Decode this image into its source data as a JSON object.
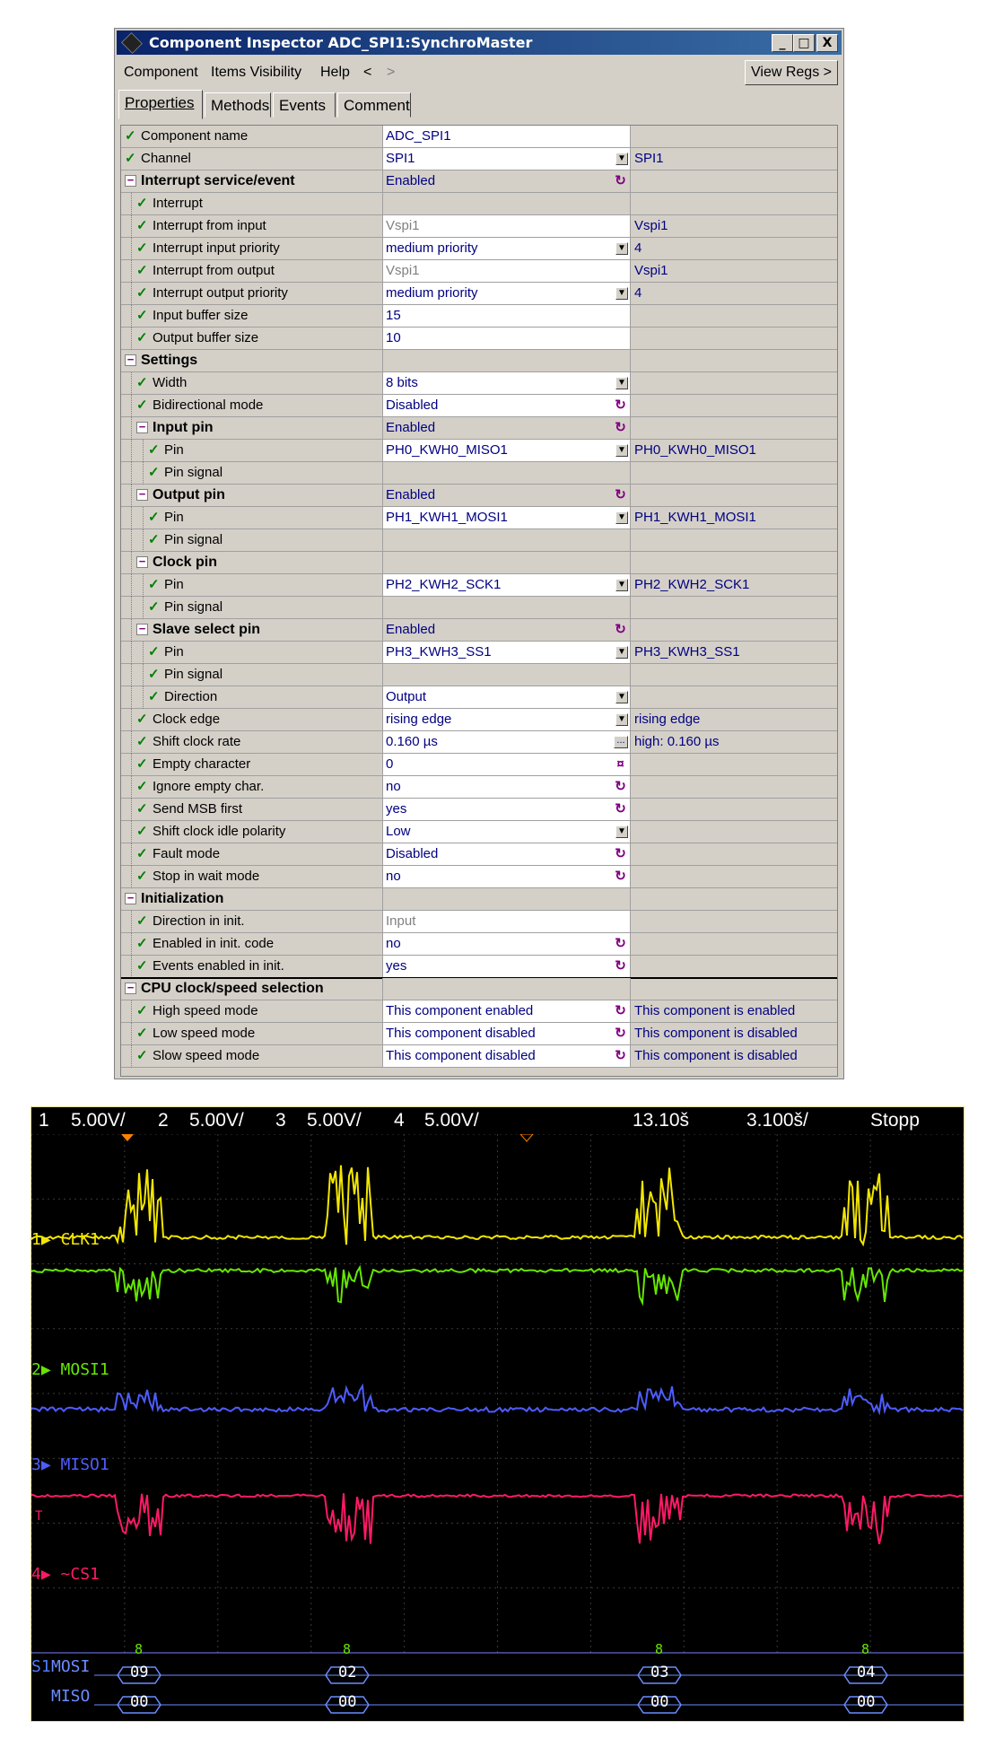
{
  "window": {
    "title": "Component Inspector ADC_SPI1:SynchroMaster",
    "buttons": {
      "minimize": "_",
      "maximize": "□",
      "close": "X"
    }
  },
  "menu": {
    "items": [
      "Component",
      "Items Visibility",
      "Help",
      "<",
      ">"
    ],
    "view_regs": "View Regs >"
  },
  "tabs": [
    "Properties",
    "Methods",
    "Events",
    "Comment"
  ],
  "rows": [
    {
      "name": "Component name",
      "value": "ADC_SPI1",
      "extra": ""
    },
    {
      "name": "Channel",
      "value": "SPI1",
      "extra": "SPI1"
    },
    {
      "name": "Interrupt service/event",
      "value": "Enabled",
      "extra": ""
    },
    {
      "name": "Interrupt",
      "value": "",
      "extra": ""
    },
    {
      "name": "Interrupt from input",
      "value": "Vspi1",
      "extra": "Vspi1"
    },
    {
      "name": "Interrupt input priority",
      "value": "medium priority",
      "extra": "4"
    },
    {
      "name": "Interrupt from output",
      "value": "Vspi1",
      "extra": "Vspi1"
    },
    {
      "name": "Interrupt output priority",
      "value": "medium priority",
      "extra": "4"
    },
    {
      "name": "Input buffer size",
      "value": "15",
      "extra": ""
    },
    {
      "name": "Output buffer size",
      "value": "10",
      "extra": ""
    },
    {
      "name": "Settings",
      "value": "",
      "extra": ""
    },
    {
      "name": "Width",
      "value": "8 bits",
      "extra": ""
    },
    {
      "name": "Bidirectional mode",
      "value": "Disabled",
      "extra": ""
    },
    {
      "name": "Input pin",
      "value": "Enabled",
      "extra": ""
    },
    {
      "name": "Pin",
      "value": "PH0_KWH0_MISO1",
      "extra": "PH0_KWH0_MISO1"
    },
    {
      "name": "Pin signal",
      "value": "",
      "extra": ""
    },
    {
      "name": "Output pin",
      "value": "Enabled",
      "extra": ""
    },
    {
      "name": "Pin",
      "value": "PH1_KWH1_MOSI1",
      "extra": "PH1_KWH1_MOSI1"
    },
    {
      "name": "Pin signal",
      "value": "",
      "extra": ""
    },
    {
      "name": "Clock pin",
      "value": "",
      "extra": ""
    },
    {
      "name": "Pin",
      "value": "PH2_KWH2_SCK1",
      "extra": "PH2_KWH2_SCK1"
    },
    {
      "name": "Pin signal",
      "value": "",
      "extra": ""
    },
    {
      "name": "Slave select pin",
      "value": "Enabled",
      "extra": ""
    },
    {
      "name": "Pin",
      "value": "PH3_KWH3_SS1",
      "extra": "PH3_KWH3_SS1"
    },
    {
      "name": "Pin signal",
      "value": "",
      "extra": ""
    },
    {
      "name": "Direction",
      "value": "Output",
      "extra": ""
    },
    {
      "name": "Clock edge",
      "value": "rising edge",
      "extra": "rising edge"
    },
    {
      "name": "Shift clock rate",
      "value": "0.160 µs",
      "extra": "high: 0.160 µs"
    },
    {
      "name": "Empty character",
      "value": "0",
      "extra": ""
    },
    {
      "name": "Ignore empty char.",
      "value": "no",
      "extra": ""
    },
    {
      "name": "Send MSB first",
      "value": "yes",
      "extra": ""
    },
    {
      "name": "Shift clock idle polarity",
      "value": "Low",
      "extra": ""
    },
    {
      "name": "Fault mode",
      "value": "Disabled",
      "extra": ""
    },
    {
      "name": "Stop in wait mode",
      "value": "no",
      "extra": ""
    },
    {
      "name": "Initialization",
      "value": "",
      "extra": ""
    },
    {
      "name": "Direction in init.",
      "value": "Input",
      "extra": ""
    },
    {
      "name": "Enabled in init. code",
      "value": "no",
      "extra": ""
    },
    {
      "name": "Events enabled in init.",
      "value": "yes",
      "extra": ""
    },
    {
      "name": "CPU clock/speed selection",
      "value": "",
      "extra": ""
    },
    {
      "name": "High speed mode",
      "value": "This component enabled",
      "extra": "This component is enabled"
    },
    {
      "name": "Low speed mode",
      "value": "This component disabled",
      "extra": "This component is disabled"
    },
    {
      "name": "Slow speed mode",
      "value": "This component disabled",
      "extra": "This component is disabled"
    }
  ],
  "scope": {
    "channels": [
      {
        "num": "1",
        "scale": "5.00V/",
        "color": "#f2e600"
      },
      {
        "num": "2",
        "scale": "5.00V/",
        "color": "#66e600"
      },
      {
        "num": "3",
        "scale": "5.00V/",
        "color": "#4d5cff"
      },
      {
        "num": "4",
        "scale": "5.00V/",
        "color": "#ff1a66"
      }
    ],
    "time_pos": "13.10š",
    "time_div": "3.100š/",
    "status": "Stopp",
    "trace_labels": [
      "CLK1",
      "MOSI1",
      "MISO1",
      "~CS1"
    ],
    "serial_label": "S1",
    "serial_lines": [
      "MOSI",
      "MISO"
    ],
    "trigger_mark": "T",
    "counts": [
      "8",
      "8",
      "8",
      "8"
    ],
    "mosi_bytes": [
      "09",
      "02",
      "03",
      "04"
    ],
    "miso_bytes": [
      "00",
      "00",
      "00",
      "00"
    ]
  }
}
